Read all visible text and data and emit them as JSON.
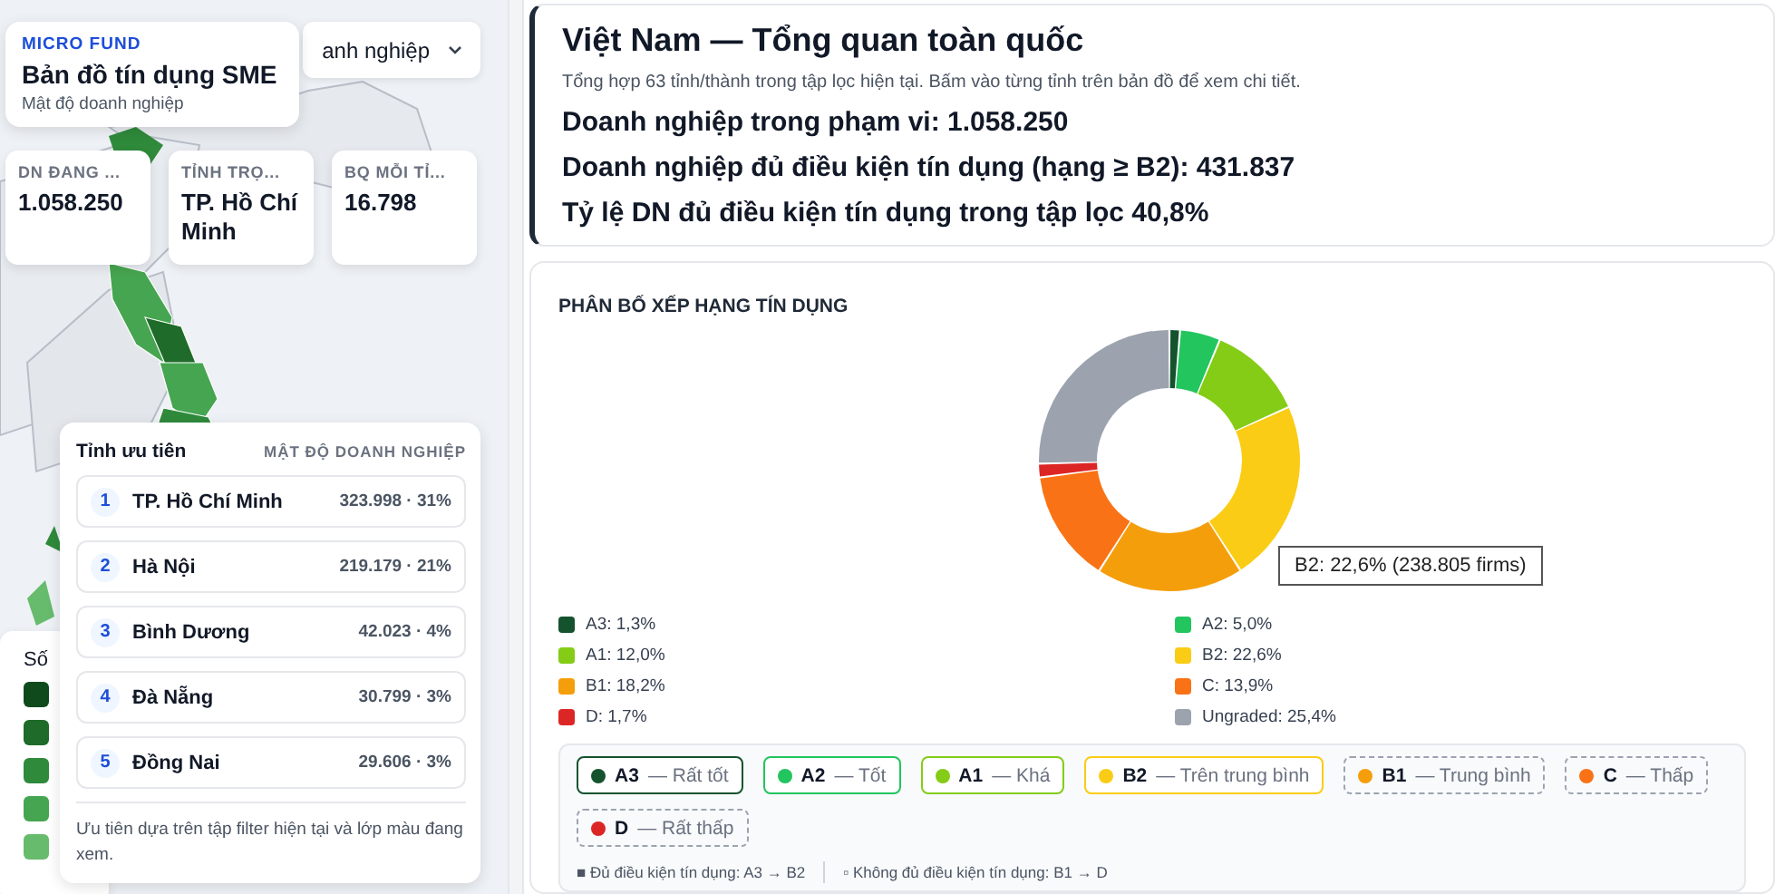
{
  "brand": {
    "eyebrow": "MICRO FUND",
    "title": "Bản đồ tín dụng SME",
    "subtitle": "Mật độ doanh nghiệp"
  },
  "layer_select": {
    "value": "anh nghiệp"
  },
  "stats": [
    {
      "label": "DN ĐANG ...",
      "value": "1.058.250"
    },
    {
      "label": "TỈNH TRỌ...",
      "value": "TP. Hồ Chí Minh"
    },
    {
      "label": "BQ MỖI TỈ...",
      "value": "16.798"
    }
  ],
  "priority": {
    "title": "Tỉnh ưu tiên",
    "metric": "MẬT ĐỘ DOANH NGHIỆP",
    "items": [
      {
        "rank": "1",
        "name": "TP. Hồ Chí Minh",
        "value": "323.998 · 31%"
      },
      {
        "rank": "2",
        "name": "Hà Nội",
        "value": "219.179 · 21%"
      },
      {
        "rank": "3",
        "name": "Bình Dương",
        "value": "42.023 · 4%"
      },
      {
        "rank": "4",
        "name": "Đà Nẵng",
        "value": "30.799 · 3%"
      },
      {
        "rank": "5",
        "name": "Đồng Nai",
        "value": "29.606 · 3%"
      }
    ],
    "note": "Ưu tiên dựa trên tập filter hiện tại và lớp màu đang xem."
  },
  "map_legend": {
    "title": "Số",
    "swatches": [
      {
        "color": "#0f4a1c"
      },
      {
        "color": "#1f6b2a"
      },
      {
        "color": "#2f8a3b"
      },
      {
        "color": "#46a550"
      },
      {
        "color": "#67bb6c"
      }
    ]
  },
  "summary": {
    "title": "Việt Nam — Tổng quan toàn quốc",
    "description": "Tổng hợp 63 tỉnh/thành trong tập lọc hiện tại. Bấm vào từng tỉnh trên bản đồ để xem chi tiết.",
    "lines": [
      "Doanh nghiệp trong phạm vi: 1.058.250",
      "Doanh nghiệp đủ điều kiện tín dụng (hạng ≥ B2): 431.837",
      "Tỷ lệ DN đủ điều kiện tín dụng trong tập lọc 40,8%"
    ]
  },
  "rating_chart": {
    "heading": "PHÂN BỐ XẾP HẠNG TÍN DỤNG",
    "tooltip": "B2: 22,6% (238.805 firms)",
    "chart_data": {
      "type": "donut",
      "values": [
        1.3,
        5.0,
        12.0,
        22.6,
        18.2,
        13.9,
        1.7,
        25.4
      ]
    },
    "legend": [
      {
        "label": "A3: 1,3%",
        "color": "#14532d"
      },
      {
        "label": "A2: 5,0%",
        "color": "#22c55e"
      },
      {
        "label": "A1: 12,0%",
        "color": "#84cc16"
      },
      {
        "label": "B2: 22,6%",
        "color": "#facc15"
      },
      {
        "label": "B1: 18,2%",
        "color": "#f59e0b"
      },
      {
        "label": "C: 13,9%",
        "color": "#f97316"
      },
      {
        "label": "D: 1,7%",
        "color": "#dc2626"
      },
      {
        "label": "Ungraded: 25,4%",
        "color": "#9ca3af"
      }
    ]
  },
  "grade_chips": [
    {
      "code": "A3",
      "desc": "— Rất tốt",
      "color": "#14532d",
      "eligible": true
    },
    {
      "code": "A2",
      "desc": "— Tốt",
      "color": "#22c55e",
      "eligible": true
    },
    {
      "code": "A1",
      "desc": "— Khá",
      "color": "#84cc16",
      "eligible": true
    },
    {
      "code": "B2",
      "desc": "— Trên trung bình",
      "color": "#facc15",
      "eligible": true
    },
    {
      "code": "B1",
      "desc": "— Trung bình",
      "color": "#f59e0b",
      "eligible": false
    },
    {
      "code": "C",
      "desc": "— Thấp",
      "color": "#f97316",
      "eligible": false
    },
    {
      "code": "D",
      "desc": "— Rất thấp",
      "color": "#dc2626",
      "eligible": false
    }
  ],
  "chip_notes": [
    "■ Đủ điều kiện tín dụng: A3 → B2",
    "▫ Không đủ điều kiện tín dụng: B1 → D"
  ]
}
